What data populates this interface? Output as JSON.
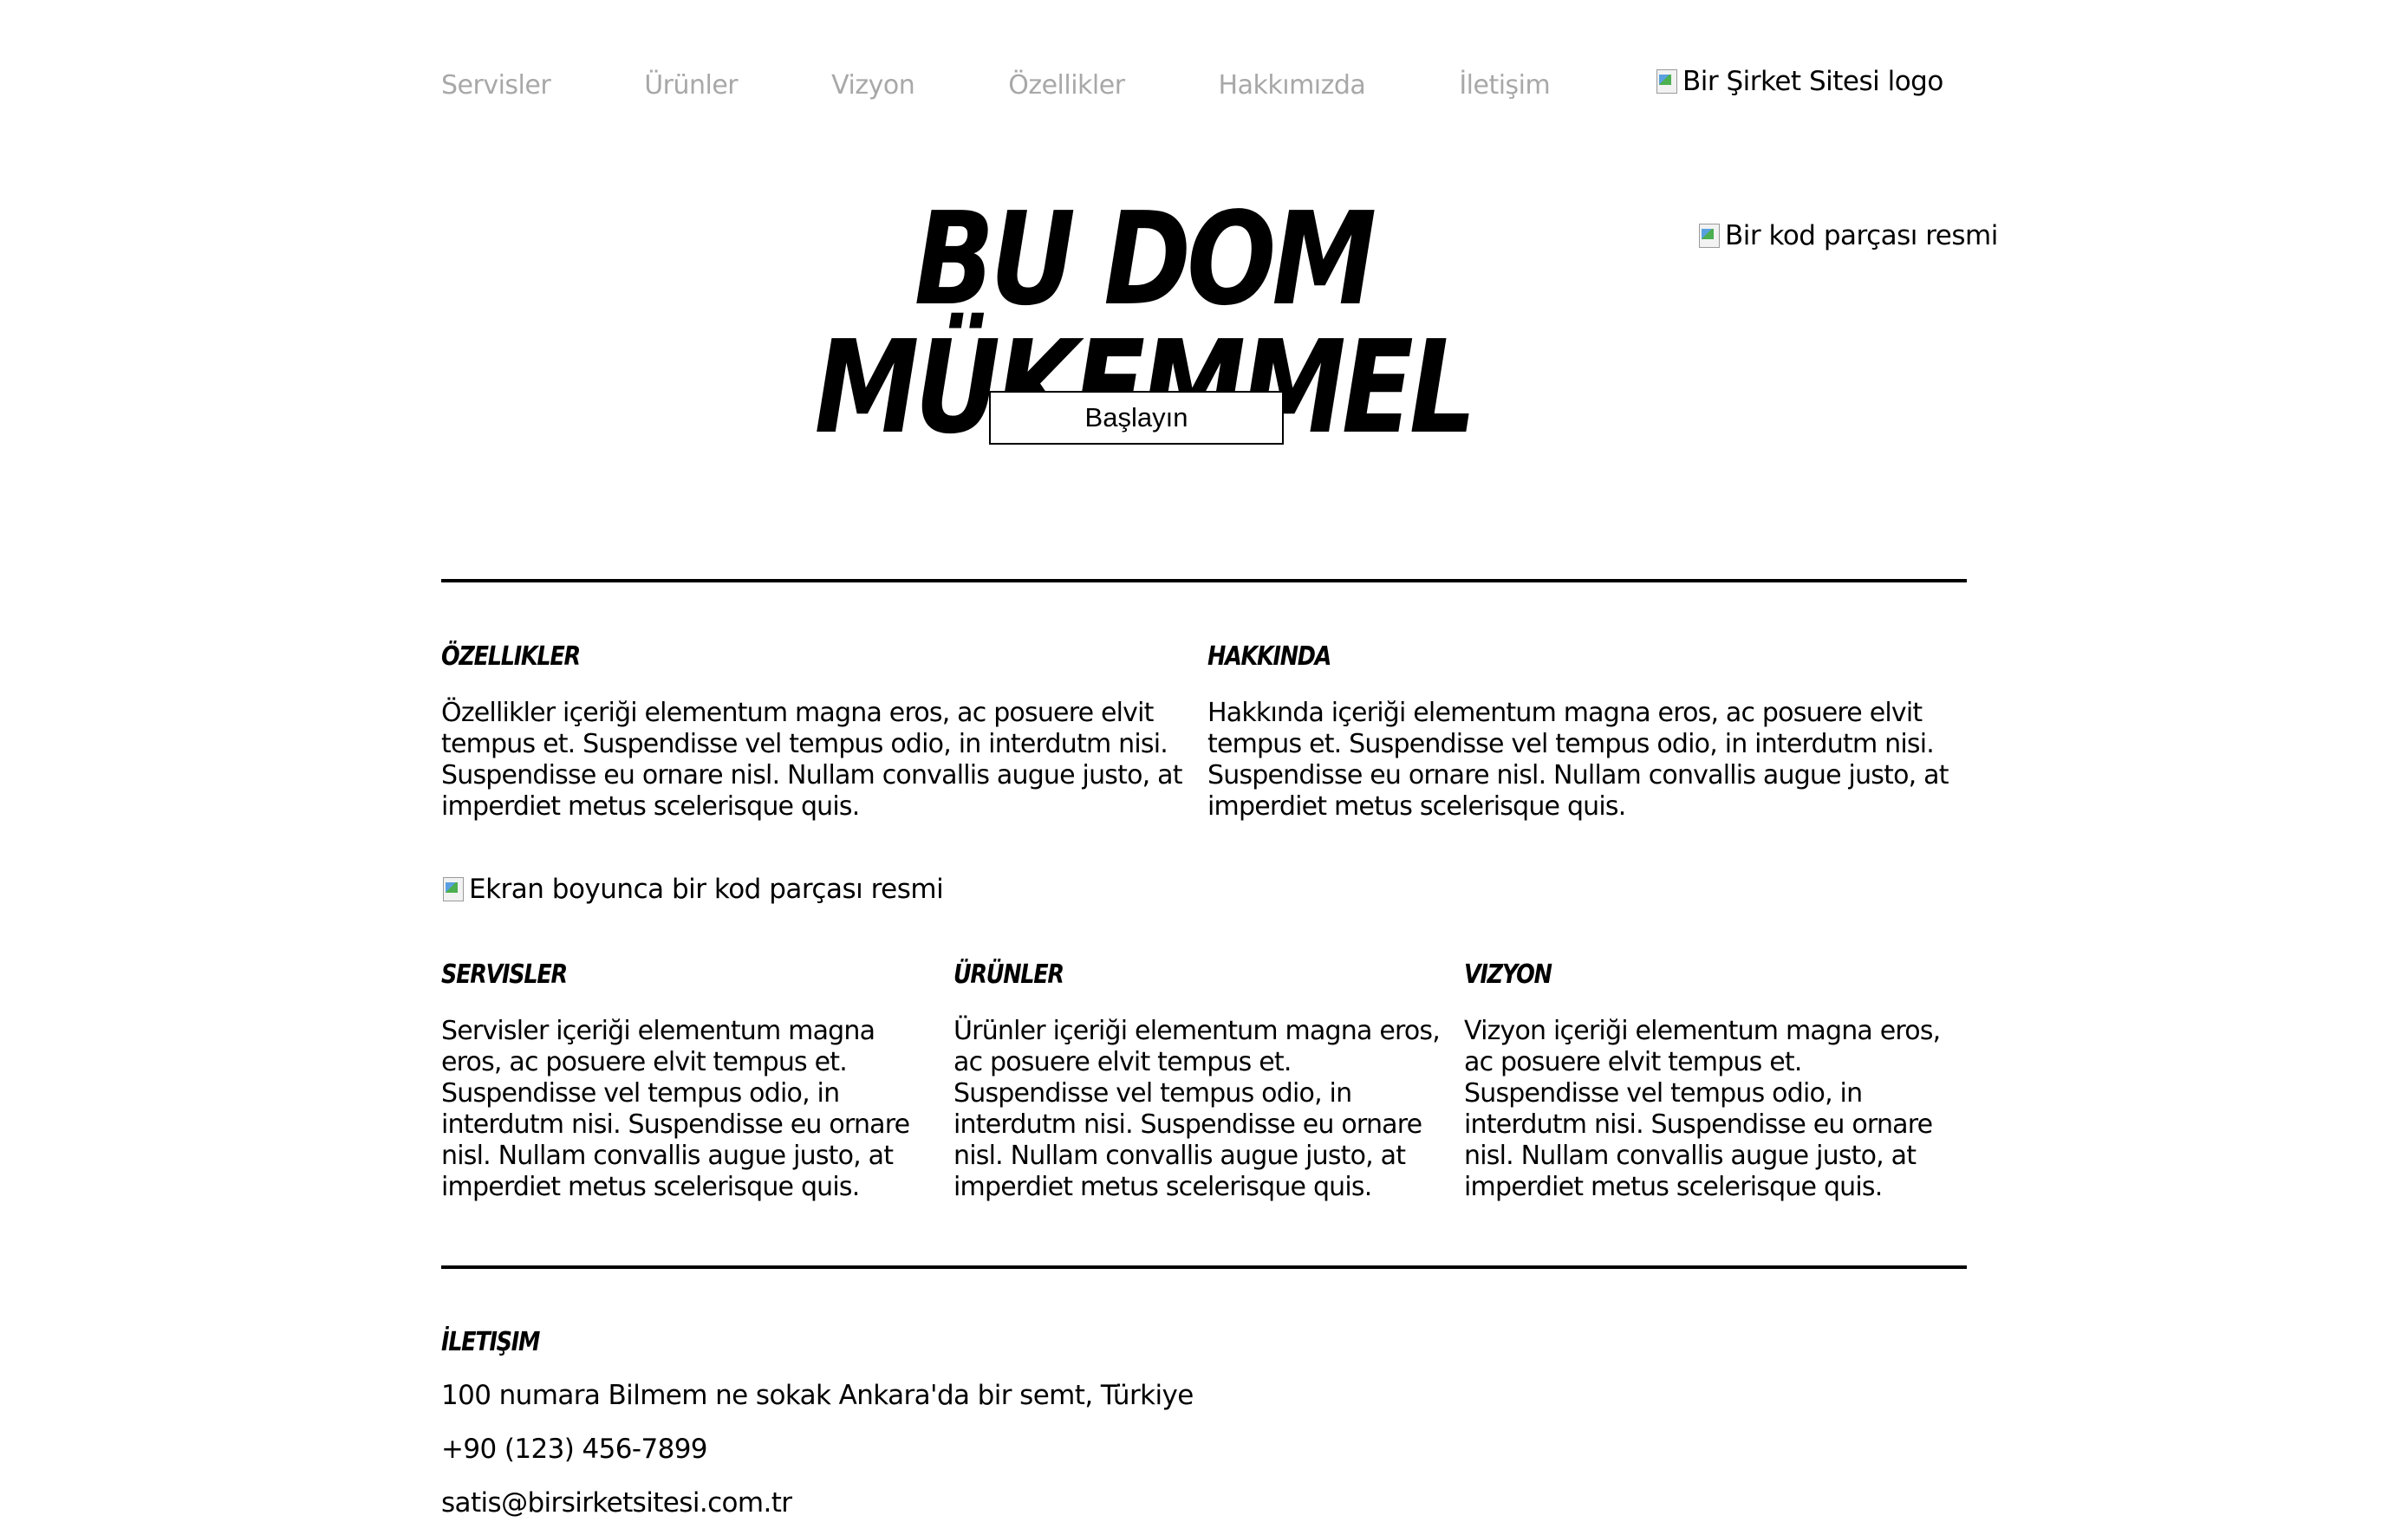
{
  "nav": {
    "items": [
      "Servisler",
      "Ürünler",
      "Vizyon",
      "Özellikler",
      "Hakkımızda",
      "İletişim"
    ]
  },
  "logo": {
    "alt": "Bir Şirket Sitesi logo",
    "icon": "broken-image-icon"
  },
  "hero": {
    "title": "BU DOM MÜKEMMEL",
    "image_alt": "Bir kod parçası resmi",
    "button_label": "Başlayın"
  },
  "features": {
    "heading": "ÖZELLIKLER",
    "text": "Özellikler içeriği elementum magna eros, ac posuere elvit tempus et. Suspendisse vel tempus odio, in interdutm nisi. Suspendisse eu ornare nisl. Nullam convallis augue justo, at imperdiet metus scelerisque quis."
  },
  "about": {
    "heading": "HAKKINDA",
    "text": "Hakkında içeriği elementum magna eros, ac posuere elvit tempus et. Suspendisse vel tempus odio, in interdutm nisi. Suspendisse eu ornare nisl. Nullam convallis augue justo, at imperdiet metus scelerisque quis."
  },
  "wide_image": {
    "alt": "Ekran boyunca bir kod parçası resmi"
  },
  "columns": [
    {
      "heading": "SERVISLER",
      "text": "Servisler içeriği elementum magna eros, ac posuere elvit tempus et. Suspendisse vel tempus odio, in interdutm nisi. Suspendisse eu ornare nisl. Nullam convallis augue justo, at imperdiet metus scelerisque quis."
    },
    {
      "heading": "ÜRÜNLER",
      "text": "Ürünler içeriği elementum magna eros, ac posuere elvit tempus et. Suspendisse vel tempus odio, in interdutm nisi. Suspendisse eu ornare nisl. Nullam convallis augue justo, at imperdiet metus scelerisque quis."
    },
    {
      "heading": "VIZYON",
      "text": "Vizyon içeriği elementum magna eros, ac posuere elvit tempus et. Suspendisse vel tempus odio, in interdutm nisi. Suspendisse eu ornare nisl. Nullam convallis augue justo, at imperdiet metus scelerisque quis."
    }
  ],
  "contact": {
    "heading": "İLETIŞIM",
    "address": "100 numara Bilmem ne sokak Ankara'da bir semt, Türkiye",
    "phone": "+90 (123) 456-7899",
    "email": "satis@birsirketsitesi.com.tr"
  },
  "colors": {
    "nav_text": "#a8a8a8",
    "text": "#000000",
    "background": "#ffffff"
  }
}
